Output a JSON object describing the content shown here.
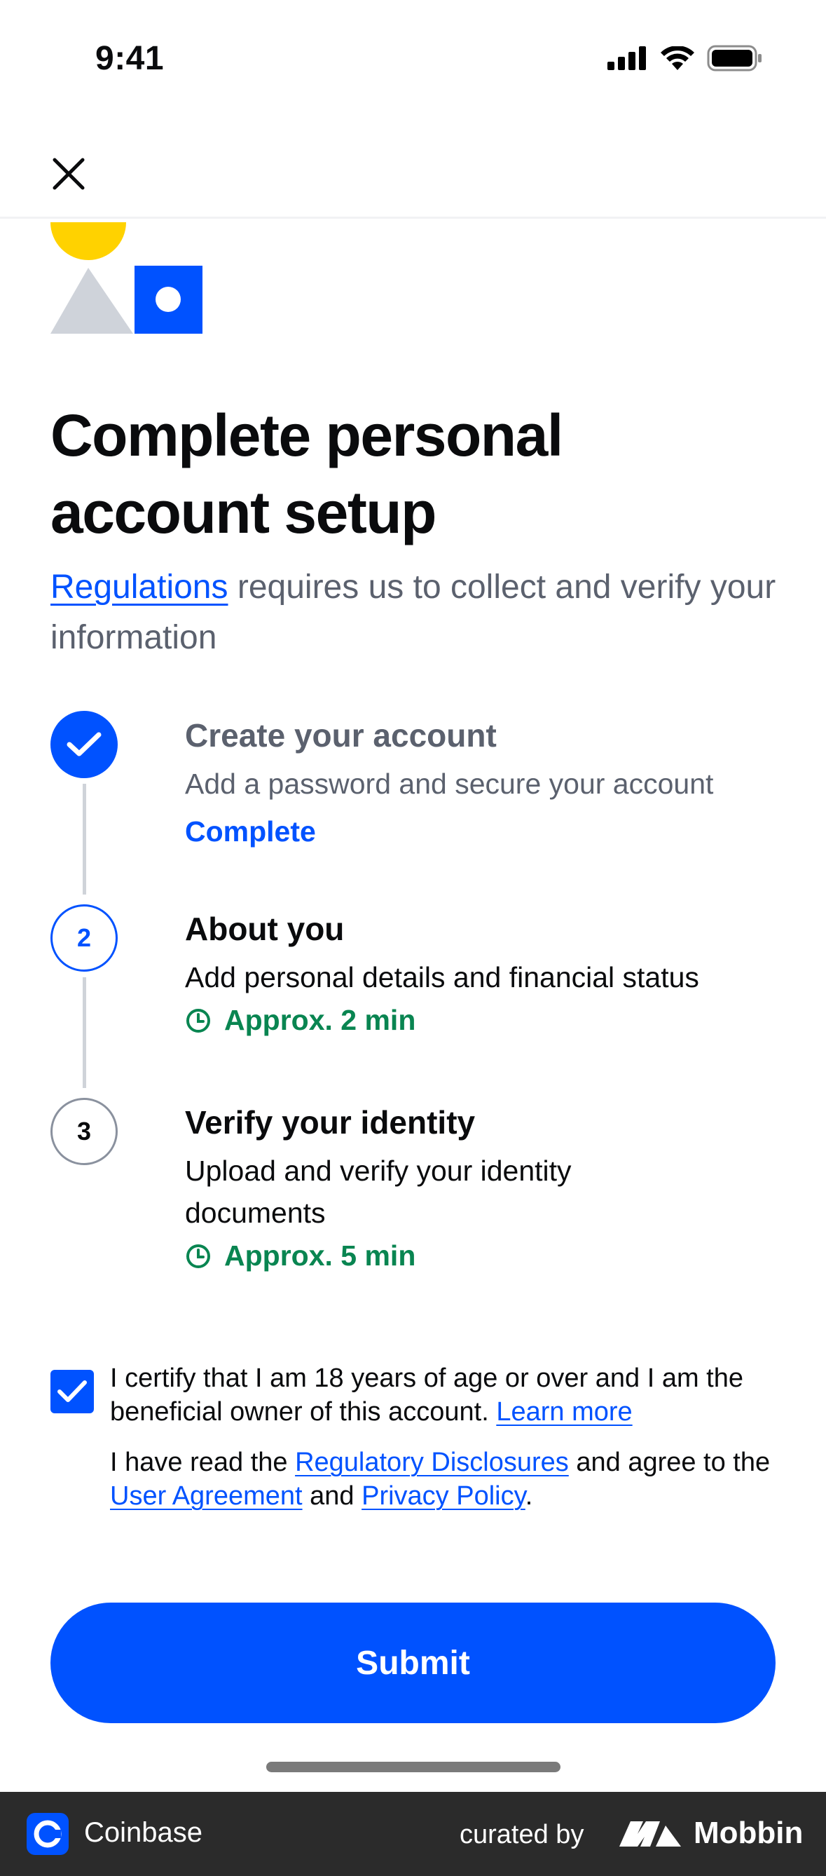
{
  "status_bar": {
    "time": "9:41"
  },
  "header": {
    "close_icon": "close-icon"
  },
  "page": {
    "title": "Complete personal account setup",
    "subtitle_link": "Regulations",
    "subtitle_rest": " requires us to collect and verify your information"
  },
  "steps": [
    {
      "number": "",
      "title": "Create your account",
      "description": "Add a password and secure your account",
      "status": "Complete",
      "state": "done"
    },
    {
      "number": "2",
      "title": "About you",
      "description": "Add personal details and financial status",
      "status": "Approx. 2 min",
      "state": "current"
    },
    {
      "number": "3",
      "title": "Verify your identity",
      "description": "Upload and verify your identity documents",
      "status": "Approx. 5 min",
      "state": "upcoming"
    }
  ],
  "certification": {
    "checked": true,
    "line1": "I certify that I am 18 years of age or over and I am the beneficial owner of this account. ",
    "learn_more": "Learn more",
    "line2_a": "I have read the ",
    "regulatory_disclosures": "Regulatory Disclosures",
    "line2_b": " and agree to the ",
    "user_agreement": "User Agreement",
    "line2_c": " and ",
    "privacy_policy": "Privacy Policy",
    "line2_d": "."
  },
  "submit": {
    "label": "Submit"
  },
  "footer": {
    "app_name": "Coinbase",
    "curated_by": "curated by",
    "brand": "Mobbin"
  },
  "colors": {
    "primary": "#0052ff",
    "success": "#098551",
    "muted": "#5b616e",
    "yellow": "#ffd200",
    "grey_shape": "#cfd3da"
  }
}
